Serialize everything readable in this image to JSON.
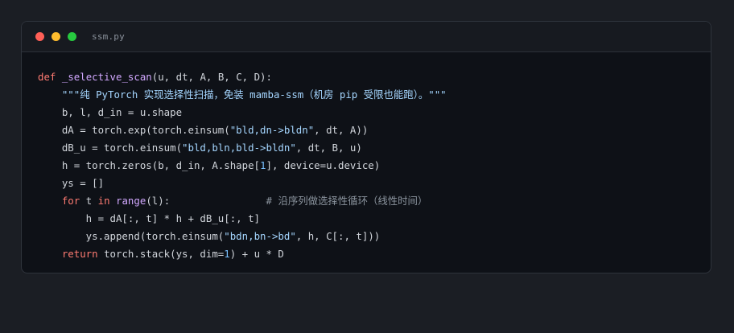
{
  "window": {
    "filename": "ssm.py",
    "controls": {
      "close_color": "#ff5f56",
      "minimize_color": "#ffbd2e",
      "maximize_color": "#27c93f"
    }
  },
  "code": {
    "language": "python",
    "lines": [
      "def _selective_scan(u, dt, A, B, C, D):",
      "    \"\"\"纯 PyTorch 实现选择性扫描，免装 mamba-ssm（机房 pip 受限也能跑）。\"\"\"",
      "    b, l, d_in = u.shape",
      "    dA = torch.exp(torch.einsum(\"bld,dn->bldn\", dt, A))",
      "    dB_u = torch.einsum(\"bld,bln,bld->bldn\", dt, B, u)",
      "    h = torch.zeros(b, d_in, A.shape[1], device=u.device)",
      "    ys = []",
      "    for t in range(l):                # 沿序列做选择性循环（线性时间）",
      "        h = dA[:, t] * h + dB_u[:, t]",
      "        ys.append(torch.einsum(\"bdn,bn->bd\", h, C[:, t]))",
      "    return torch.stack(ys, dim=1) + u * D"
    ]
  }
}
